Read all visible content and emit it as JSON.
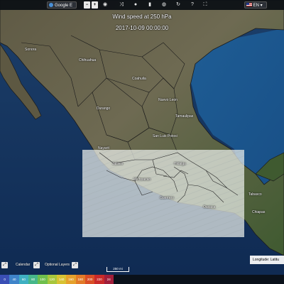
{
  "toolbar": {
    "basemap_label": "Google E",
    "language": "EN",
    "zoom_out": "−",
    "zoom_in": "+",
    "icons": [
      "shuffle-icon",
      "drop-icon",
      "bar-signal-icon",
      "globe-icon",
      "refresh-icon",
      "help-icon"
    ]
  },
  "title": {
    "line1": "Wind speed at 250 hPa",
    "line2": "2017-10-09 00:00:00"
  },
  "cities": [
    {
      "name": "Sonora"
    },
    {
      "name": "Chihuahua"
    },
    {
      "name": "Coahuila"
    },
    {
      "name": "Durango"
    },
    {
      "name": "Nuevo Leon"
    },
    {
      "name": "Tamaulipas"
    },
    {
      "name": "San Luis Potosi"
    },
    {
      "name": "Nayarit"
    },
    {
      "name": "Jalisco"
    },
    {
      "name": "Michoacan"
    },
    {
      "name": "Guerrero"
    },
    {
      "name": "Oaxaca"
    },
    {
      "name": "Hidalgo"
    },
    {
      "name": "Tabasco"
    },
    {
      "name": "Chiapas"
    }
  ],
  "controls": {
    "calendar_label": "Calendar",
    "optional_layers_label": "Optional Layers",
    "scale_label": "250 mi",
    "coord_label": "Longitude: Latitu"
  },
  "legend": {
    "values": [
      "0",
      "40",
      "60",
      "80",
      "100",
      "120",
      "140",
      "160",
      "180",
      "200",
      "220",
      "24"
    ],
    "colors": [
      "#3a4fb5",
      "#3f84c9",
      "#3fb0c2",
      "#46b78a",
      "#6fbf4d",
      "#a8c63c",
      "#d8c233",
      "#e5a12c",
      "#e27a28",
      "#d94e26",
      "#c82a2a",
      "#a01e3a"
    ]
  }
}
